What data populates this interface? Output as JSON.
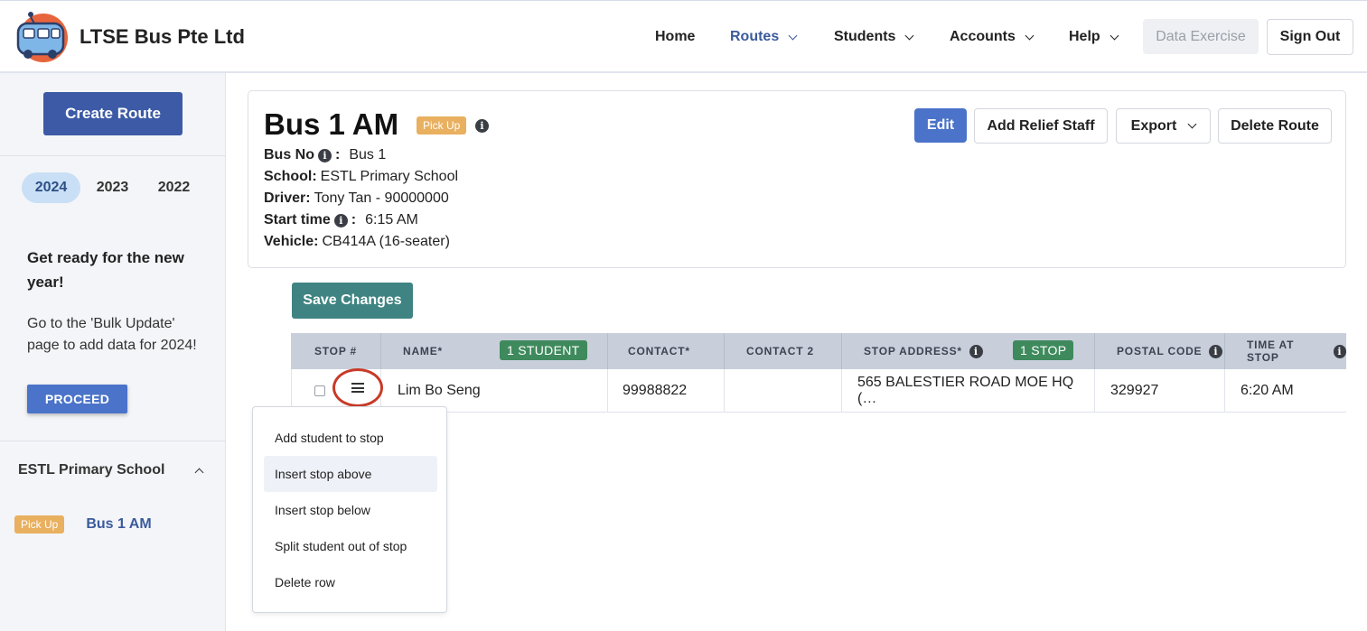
{
  "header": {
    "brand": "LTSE Bus Pte Ltd",
    "nav": [
      {
        "label": "Home",
        "dropdown": false
      },
      {
        "label": "Routes",
        "dropdown": true,
        "active": true
      },
      {
        "label": "Students",
        "dropdown": true
      },
      {
        "label": "Accounts",
        "dropdown": true
      },
      {
        "label": "Help",
        "dropdown": true
      }
    ],
    "data_exercise_label": "Data Exercise",
    "sign_out_label": "Sign Out"
  },
  "sidebar": {
    "create_route_label": "Create Route",
    "years": [
      "2024",
      "2023",
      "2022"
    ],
    "active_year": "2024",
    "promo_title": "Get ready for the new year!",
    "promo_text": "Go to the 'Bulk Update' page to add data for 2024!",
    "proceed_label": "PROCEED",
    "school_name": "ESTL Primary School",
    "route_badge": "Pick Up",
    "route_name": "Bus 1 AM"
  },
  "route": {
    "title": "Bus 1 AM",
    "badge": "Pick Up",
    "bus_no_label": "Bus No",
    "bus_no_value": "Bus 1",
    "school_label": "School:",
    "school_value": "ESTL Primary School",
    "driver_label": "Driver:",
    "driver_value": "Tony Tan - 90000000",
    "start_time_label": "Start time",
    "start_time_value": "6:15 AM",
    "vehicle_label": "Vehicle:",
    "vehicle_value": "CB414A (16-seater)",
    "actions": {
      "edit": "Edit",
      "add_relief_staff": "Add Relief Staff",
      "export": "Export",
      "delete_route": "Delete Route"
    }
  },
  "save_changes_label": "Save Changes",
  "table": {
    "columns": {
      "stop": "STOP #",
      "name": "NAME*",
      "name_tag": "1 STUDENT",
      "contact": "CONTACT*",
      "contact2": "CONTACT 2",
      "address": "STOP ADDRESS*",
      "address_tag": "1 STOP",
      "postal": "POSTAL CODE",
      "time": "TIME AT STOP"
    },
    "rows": [
      {
        "name": "Lim Bo Seng",
        "contact": "99988822",
        "contact2": "",
        "address": "565 BALESTIER ROAD MOE HQ (…",
        "postal": "329927",
        "time": "6:20 AM"
      }
    ]
  },
  "context_menu": {
    "items": [
      "Add student to stop",
      "Insert stop above",
      "Insert stop below",
      "Split student out of stop",
      "Delete row"
    ],
    "highlighted_index": 1
  }
}
